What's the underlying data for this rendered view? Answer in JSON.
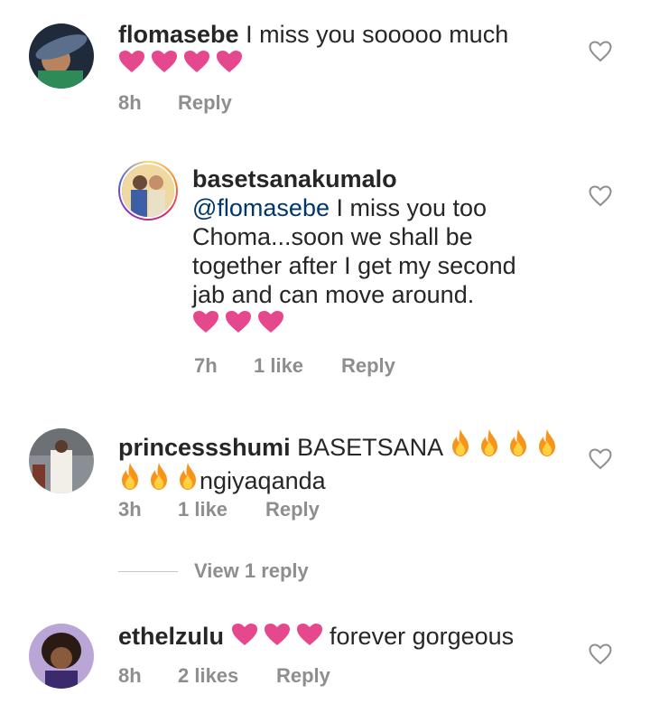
{
  "comments": [
    {
      "username": "flomasebe",
      "text": "I miss you sooooo much",
      "emoji": [
        "heart",
        "heart",
        "heart",
        "heart"
      ],
      "time": "8h",
      "likes": "",
      "reply": "Reply",
      "avatar_icon": "woman-in-hat-avatar"
    },
    {
      "username": "basetsanakumalo",
      "mention": "@flomasebe",
      "text_line1": " I miss you too",
      "text_line2": "Choma...soon we shall be",
      "text_line3": "together after I get my second",
      "text_line4": "jab and can move around.",
      "emoji": [
        "heart",
        "heart",
        "heart"
      ],
      "time": "7h",
      "likes": "1 like",
      "reply": "Reply",
      "avatar_icon": "couple-avatar"
    },
    {
      "username": "princessshumi",
      "text": "BASETSANA",
      "text_tail": "ngiyaqanda",
      "emoji_count_line1": 4,
      "emoji_count_line2": 3,
      "time": "3h",
      "likes": "1 like",
      "reply": "Reply",
      "view_replies": "View 1 reply",
      "avatar_icon": "woman-standing-avatar"
    },
    {
      "username": "ethelzulu",
      "text": "forever gorgeous",
      "emoji": [
        "heart",
        "heart",
        "heart"
      ],
      "time": "8h",
      "likes": "2 likes",
      "reply": "Reply",
      "avatar_icon": "woman-purple-avatar"
    }
  ],
  "colors": {
    "heart_emoji": "#e6488d",
    "mention": "#00376b",
    "meta": "#8e8e8e",
    "like_icon": "#8e8e8e"
  }
}
